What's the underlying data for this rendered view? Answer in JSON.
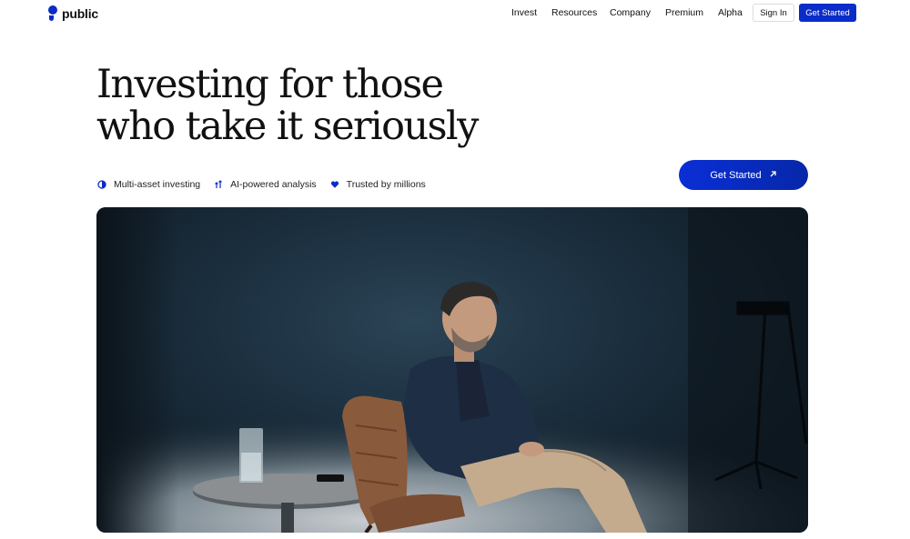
{
  "theme": {
    "accent": "#0a2cc8"
  },
  "header": {
    "logo_text": "public",
    "nav": [
      "Invest",
      "Resources",
      "Company",
      "Premium",
      "Alpha"
    ],
    "sign_in_label": "Sign In",
    "get_started_label": "Get Started"
  },
  "hero": {
    "headline_line1": "Investing for those",
    "headline_line2": "who take it seriously",
    "features": [
      {
        "icon": "half-circle-icon",
        "label": "Multi-asset investing"
      },
      {
        "icon": "trend-arrows-icon",
        "label": "AI-powered analysis"
      },
      {
        "icon": "heart-icon",
        "label": "Trusted by millions"
      }
    ],
    "cta_label": "Get Started",
    "cta_icon": "arrow-up-right-icon"
  }
}
